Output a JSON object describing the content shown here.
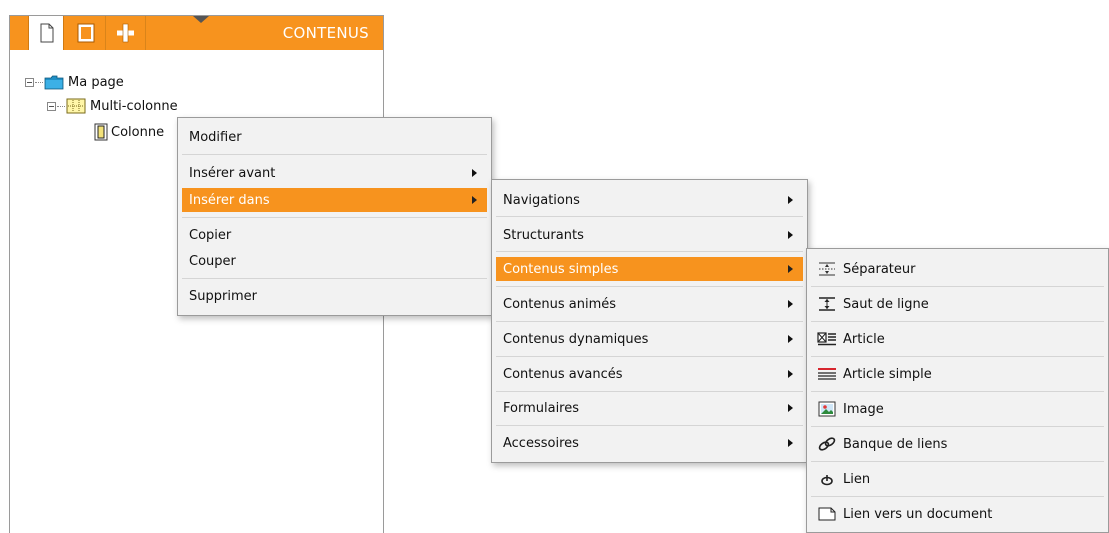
{
  "panel": {
    "title": "CONTENUS",
    "tabs": [
      {
        "icon": "page-icon"
      },
      {
        "icon": "frame-icon"
      },
      {
        "icon": "plus-icon"
      }
    ]
  },
  "tree": {
    "root": {
      "label": "Ma page",
      "icon": "folder-icon"
    },
    "child": {
      "label": "Multi-colonne",
      "icon": "grid-icon"
    },
    "grandchild": {
      "label": "Colonne",
      "icon": "column-icon"
    }
  },
  "context_menu": {
    "items": [
      {
        "label": "Modifier"
      },
      {
        "label": "Insérer avant",
        "submenu": true
      },
      {
        "label": "Insérer dans",
        "submenu": true,
        "highlighted": true
      },
      {
        "label": "Copier"
      },
      {
        "label": "Couper"
      },
      {
        "label": "Supprimer"
      }
    ]
  },
  "submenu_categories": {
    "items": [
      {
        "label": "Navigations"
      },
      {
        "label": "Structurants"
      },
      {
        "label": "Contenus simples",
        "highlighted": true
      },
      {
        "label": "Contenus animés"
      },
      {
        "label": "Contenus dynamiques"
      },
      {
        "label": "Contenus avancés"
      },
      {
        "label": "Formulaires"
      },
      {
        "label": "Accessoires"
      }
    ]
  },
  "submenu_simple": {
    "items": [
      {
        "label": "Séparateur",
        "icon": "separator-icon"
      },
      {
        "label": "Saut de ligne",
        "icon": "line-break-icon"
      },
      {
        "label": "Article",
        "icon": "article-icon"
      },
      {
        "label": "Article simple",
        "icon": "simple-article-icon"
      },
      {
        "label": "Image",
        "icon": "image-icon"
      },
      {
        "label": "Banque de liens",
        "icon": "link-bank-icon"
      },
      {
        "label": "Lien",
        "icon": "link-icon"
      },
      {
        "label": "Lien vers un document",
        "icon": "document-icon"
      }
    ]
  },
  "colors": {
    "accent": "#f7931e",
    "menu_bg": "#f2f2f2"
  }
}
